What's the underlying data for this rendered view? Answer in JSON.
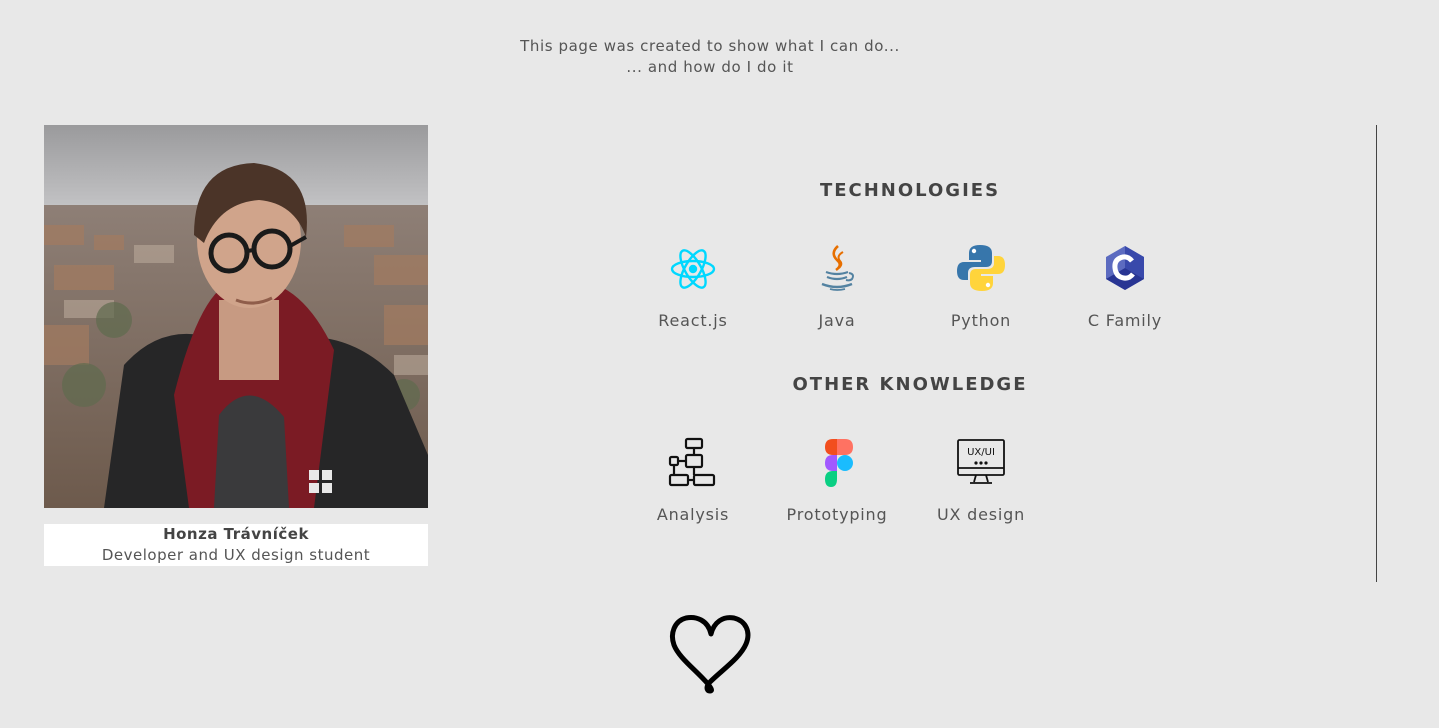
{
  "intro": {
    "line1": "This page was created to show what I can do...",
    "line2": "... and how do I do it"
  },
  "profile": {
    "name": "Honza Trávníček",
    "role": "Developer and UX design student"
  },
  "technologies": {
    "title": "TECHNOLOGIES",
    "items": [
      {
        "label": "React.js",
        "icon": "react-icon"
      },
      {
        "label": "Java",
        "icon": "java-icon"
      },
      {
        "label": "Python",
        "icon": "python-icon"
      },
      {
        "label": "C Family",
        "icon": "c-family-icon"
      }
    ]
  },
  "other_knowledge": {
    "title": "OTHER KNOWLEDGE",
    "items": [
      {
        "label": "Analysis",
        "icon": "flowchart-icon"
      },
      {
        "label": "Prototyping",
        "icon": "figma-icon"
      },
      {
        "label": "UX design",
        "icon": "ux-ui-monitor-icon"
      }
    ]
  },
  "ux_icon_text": "UX/UI",
  "footer": {
    "icon": "heart-icon"
  },
  "colors": {
    "background": "#e8e8e8",
    "text": "#444444",
    "react": "#00d8ff",
    "java_orange": "#e76f00",
    "java_blue": "#5382a1",
    "python_blue": "#3776ab",
    "python_yellow": "#ffd43b",
    "c_purple": "#5c6bc0"
  }
}
